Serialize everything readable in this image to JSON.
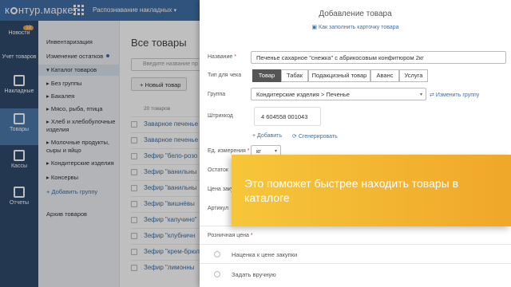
{
  "app": {
    "logo_prefix": "к",
    "logo_suffix": "нтур.маркет",
    "nav_item": "Распознавание накладных"
  },
  "sidebar": {
    "items": [
      {
        "label": "Новости",
        "badge": "13",
        "icon": "news-icon"
      },
      {
        "label": "Учет товаров",
        "icon": "boxes-icon"
      },
      {
        "label": "Накладные",
        "icon": "document-icon"
      },
      {
        "label": "Товары",
        "icon": "box-icon"
      },
      {
        "label": "Кассы",
        "icon": "cash-register-icon"
      },
      {
        "label": "Отчеты",
        "icon": "chart-icon"
      }
    ]
  },
  "menu": {
    "items": [
      "Инвентаризация",
      "Изменение остатков",
      "Каталог товаров",
      "Без группы",
      "Бакалея",
      "Мясо, рыба, птица",
      "Хлеб и хлебобулочные изделия",
      "Молочные продукты, сыры и яйцо",
      "Кондитерские изделия",
      "Консервы",
      "Добавить группу",
      "Архив товаров"
    ]
  },
  "content": {
    "title": "Все товары",
    "search_placeholder": "Введите название пр",
    "new_button": "Новый товар",
    "count": "20 товаров",
    "products": [
      "Заварное печенье",
      "Заварное печенье",
      "Зефир \"бело-розо",
      "Зефир \"ванильны",
      "Зефир \"ванильны",
      "Зефир \"вишнёвы",
      "Зефир \"капучино\"",
      "Зефир \"клубничн",
      "Зефир \"крем-брюл",
      "Зефир \"лимонны"
    ]
  },
  "modal": {
    "title": "Добавление товара",
    "help_link": "Как заполнить карточку товара",
    "name_label": "Название",
    "name_value": "Печенье сахарное \"снежка\" с абрикосовым конфитюром 2кг",
    "check_type_label": "Тип для чека",
    "check_types": [
      "Товар",
      "Табак",
      "Подакцизный товар",
      "Аванс",
      "Услуга"
    ],
    "group_label": "Группа",
    "group_value": "Кондитерские изделия > Печенье",
    "group_change": "Изменить группу",
    "barcode_label": "Штрихкод",
    "barcode_value": "4 604558 001043",
    "add_link": "Добавить",
    "generate_link": "Сгенерировать",
    "unit_label": "Ед. измерения",
    "unit_value": "кг",
    "stock_label": "Остаток",
    "purchase_label": "Цена заку",
    "article_label": "Артикул",
    "retail_label": "Розничная цена",
    "radio_markup": "Наценка к цене закупки",
    "radio_manual": "Задать вручную"
  },
  "tooltip": {
    "text": "Это поможет быстрее находить товары в каталоге"
  },
  "colors": {
    "topbar": "#3f6fa6",
    "sidebar": "#2f4b6b",
    "tooltip": "#f6c63a"
  }
}
